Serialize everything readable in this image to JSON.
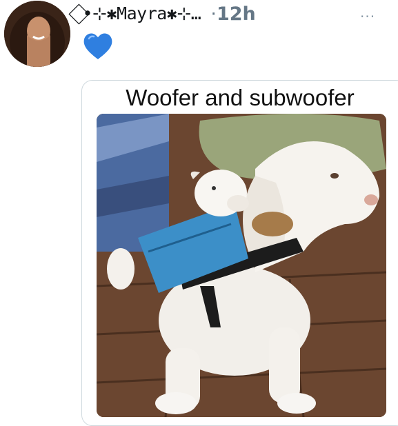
{
  "tweet": {
    "author": {
      "display_name": "⃟•⊹✱Mayra✱⊹…",
      "avatar_icon": "profile-photo"
    },
    "separator": "·",
    "time": "12h",
    "more_label": "···",
    "emoji_icon": "blue-heart-icon",
    "media": {
      "caption": "Woofer and subwoofer",
      "image_icon": "dog-with-puppy-backpack-photo"
    }
  },
  "colors": {
    "heart": "#2f7fe0",
    "meta_text": "#657786",
    "border": "#cfd9de"
  }
}
